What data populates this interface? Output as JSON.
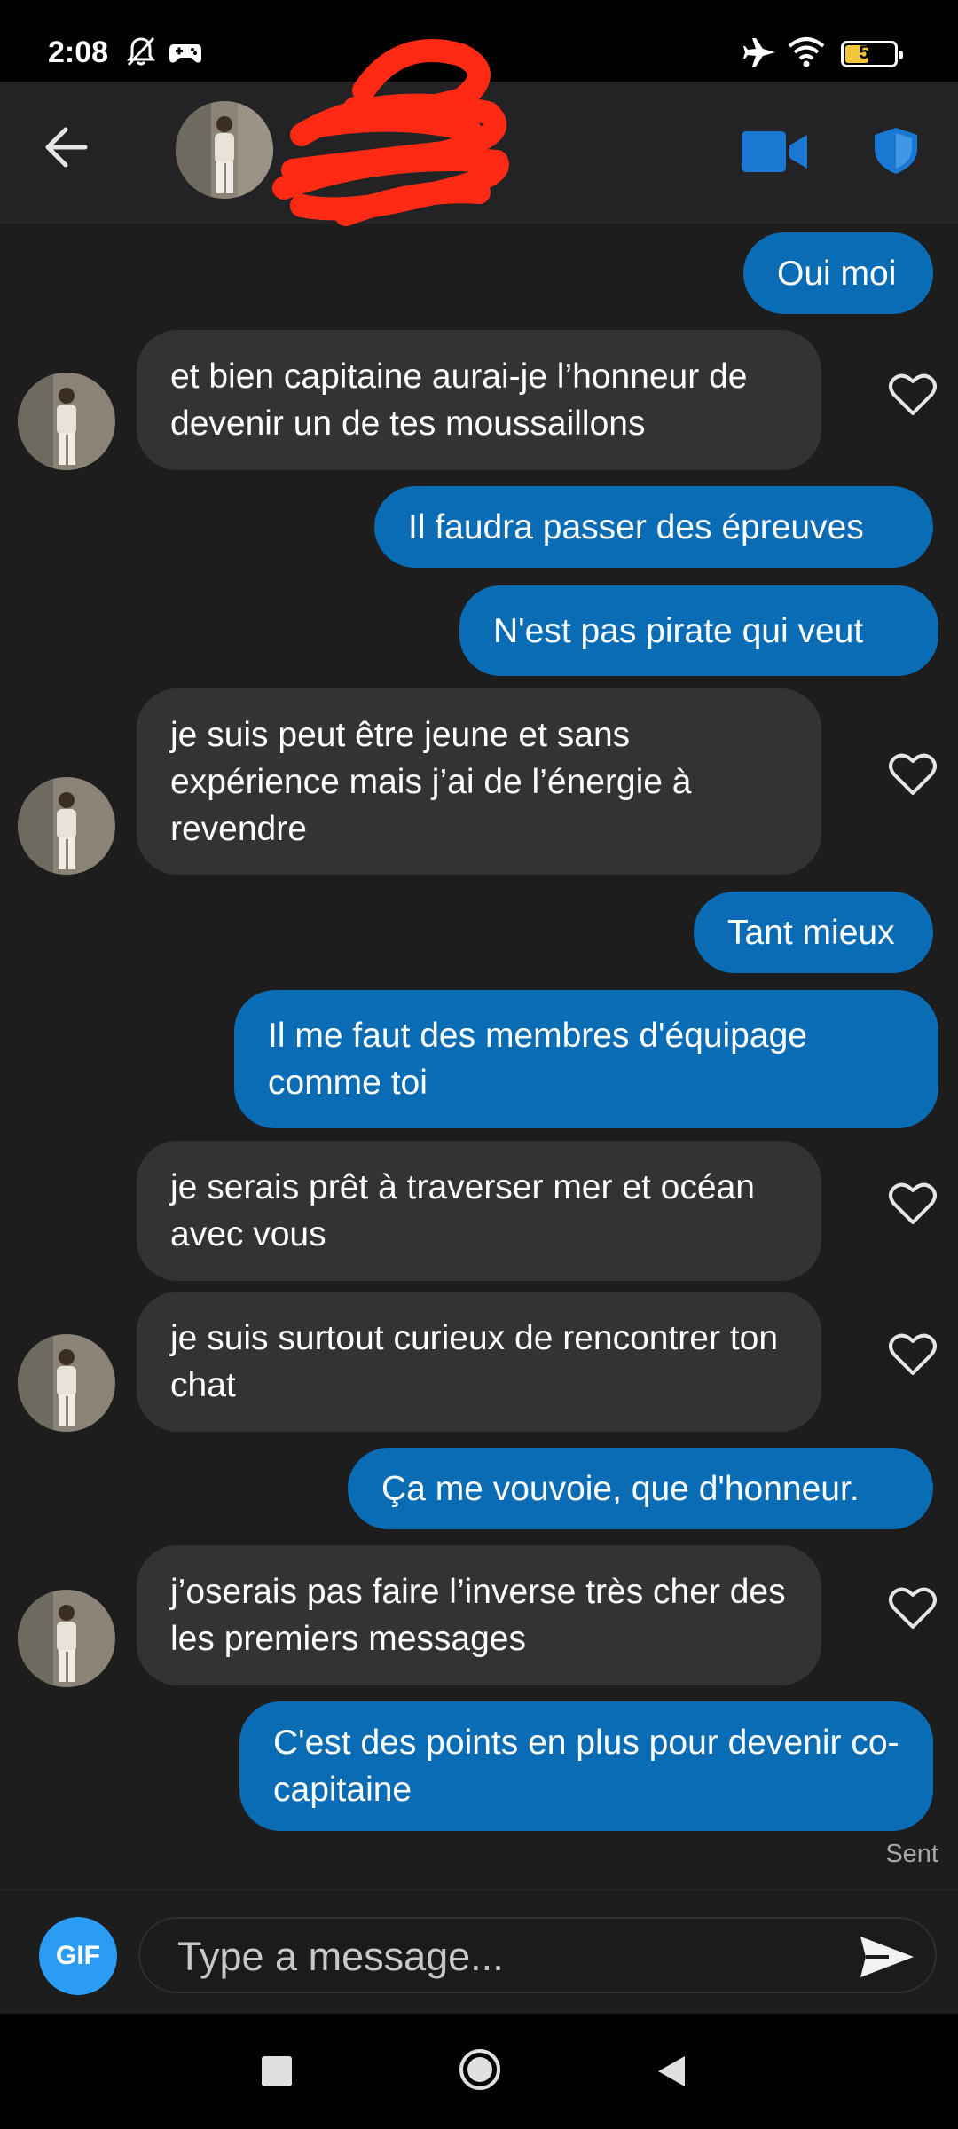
{
  "status_bar": {
    "time": "2:08",
    "battery_level": "50",
    "icons": [
      "bell-muted-icon",
      "game-controller-icon",
      "airplane-icon",
      "wifi-icon",
      "battery-icon"
    ]
  },
  "header": {
    "icons": [
      "back-arrow-icon",
      "video-camera-icon",
      "shield-icon"
    ],
    "accent_color": "#1a78d2"
  },
  "messages": [
    {
      "dir": "out",
      "text": "Oui moi"
    },
    {
      "dir": "in",
      "text": "et bien capitaine aurai-je l’honneur de devenir un de tes moussaillons"
    },
    {
      "dir": "out",
      "text": "Il faudra passer des épreuves"
    },
    {
      "dir": "out",
      "text": "N'est pas pirate qui veut"
    },
    {
      "dir": "in",
      "text": "je suis peut être jeune et sans expérience mais j’ai de l’énergie à revendre"
    },
    {
      "dir": "out",
      "text": "Tant mieux"
    },
    {
      "dir": "out",
      "text": "Il me faut des membres d'équipage comme toi"
    },
    {
      "dir": "in",
      "text": "je serais prêt à traverser mer et océan avec vous"
    },
    {
      "dir": "in",
      "text": "je suis surtout curieux de rencontrer ton chat"
    },
    {
      "dir": "out",
      "text": "Ça me vouvoie, que d'honneur."
    },
    {
      "dir": "in",
      "text": "j’oserais pas faire l’inverse très cher des les premiers messages"
    },
    {
      "dir": "out",
      "text": "C'est des points en plus pour devenir co-capitaine"
    }
  ],
  "sent_label": "Sent",
  "composer": {
    "gif_label": "GIF",
    "placeholder": "Type a message..."
  },
  "colors": {
    "outgoing_bubble": "#0a6cb5",
    "incoming_bubble": "#333335",
    "background": "#1d1d1e",
    "gif_button": "#2a9cf3"
  }
}
